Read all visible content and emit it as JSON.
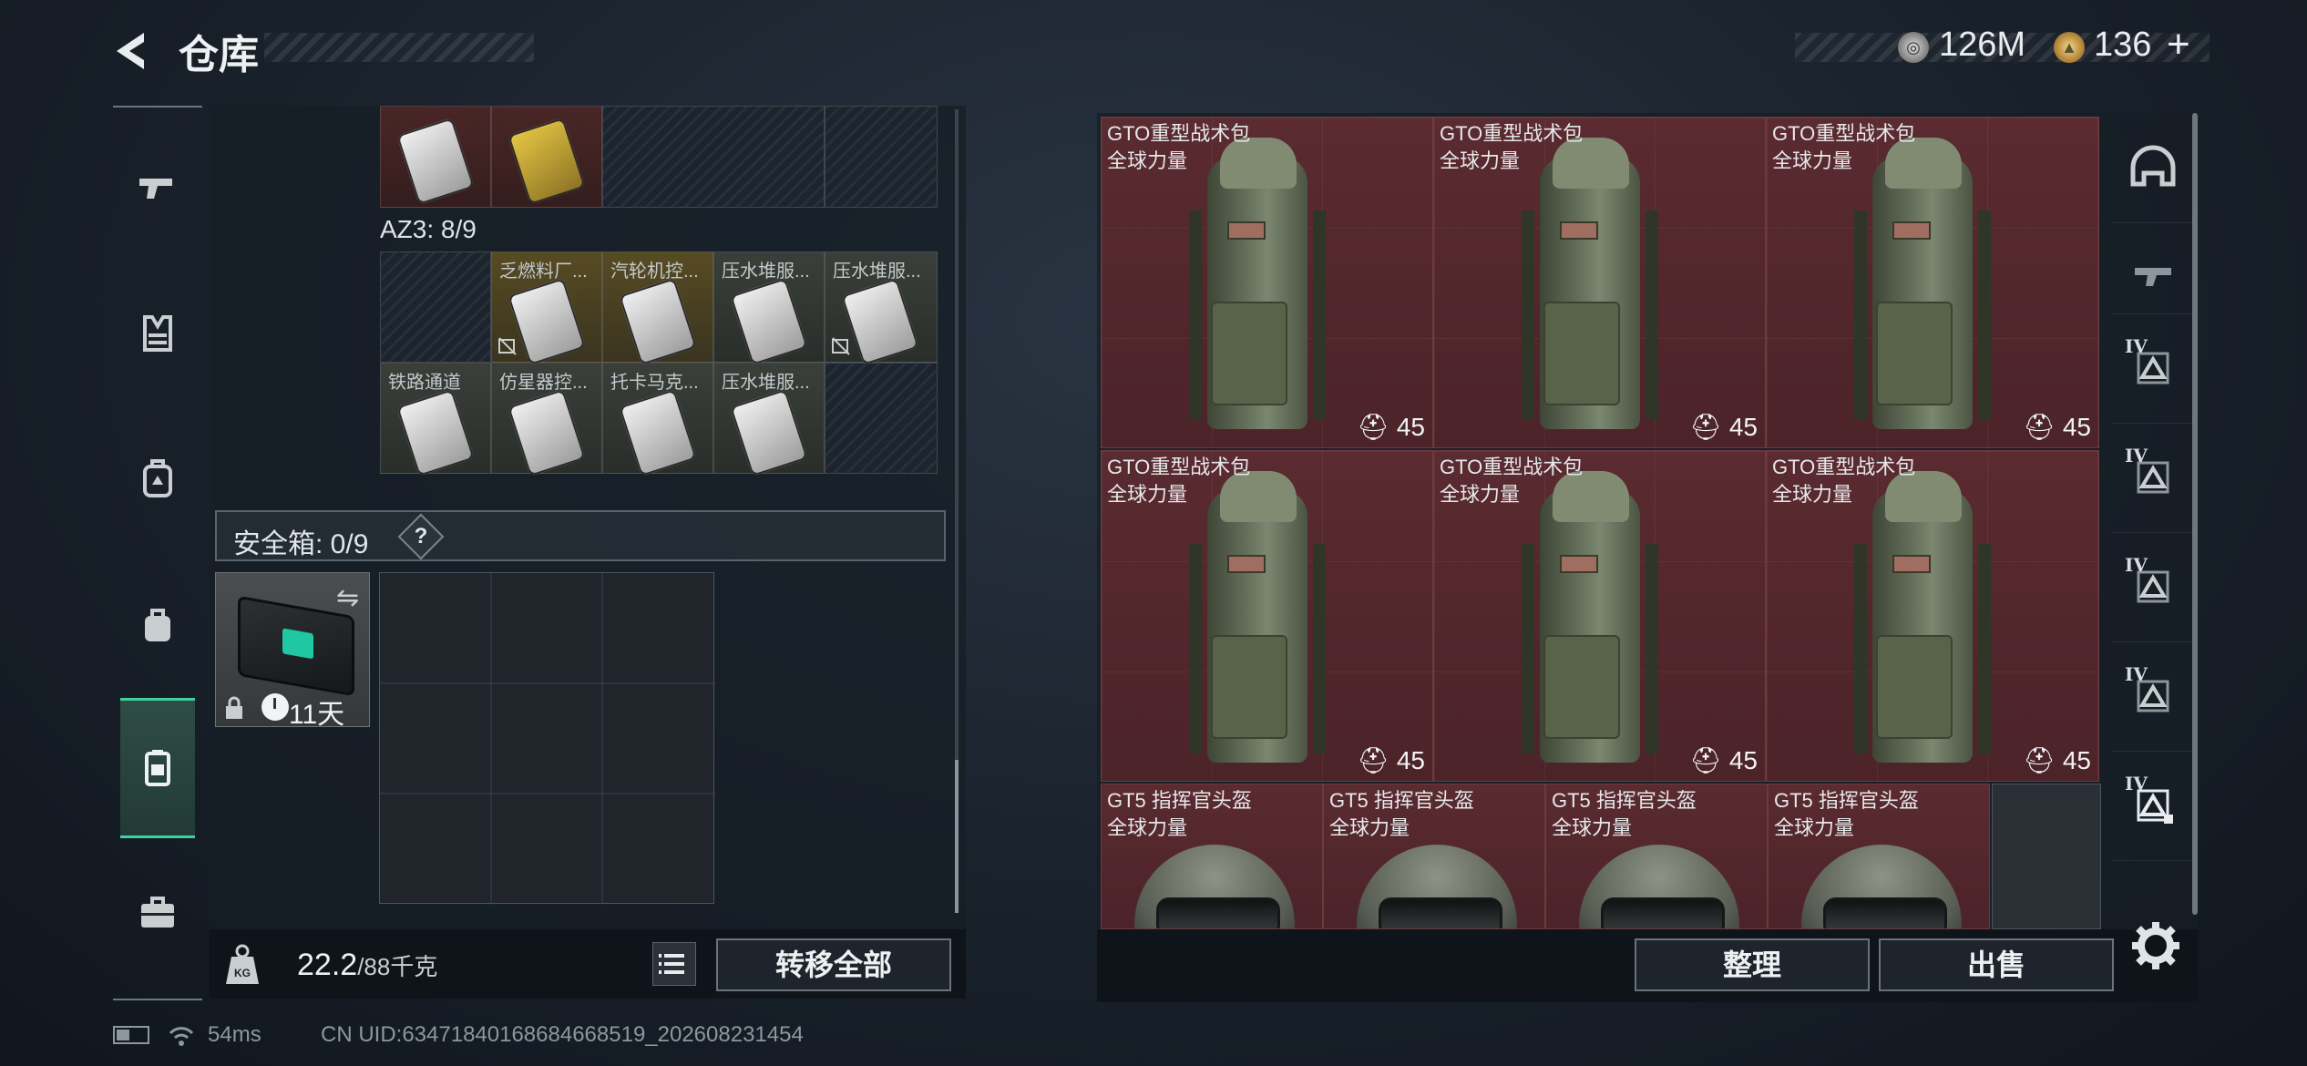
{
  "header": {
    "title": "仓库",
    "currency_silver": "126M",
    "currency_gold": "136",
    "plus": "+"
  },
  "left_nav": [
    "pistol-icon",
    "vest-icon",
    "backpack-icon",
    "bag-icon",
    "container-icon",
    "briefcase-icon"
  ],
  "key_section": {
    "label": "AZ3: 8/9",
    "keys": [
      {
        "name": "乏燃料厂...",
        "color": "yellow"
      },
      {
        "name": "汽轮机控...",
        "color": "yellow"
      },
      {
        "name": "压水堆服...",
        "color": "grey"
      },
      {
        "name": "压水堆服...",
        "color": "grey"
      },
      {
        "name": "铁路通道",
        "color": "grey"
      },
      {
        "name": "仿星器控...",
        "color": "grey"
      },
      {
        "name": "托卡马克...",
        "color": "grey"
      },
      {
        "name": "压水堆服...",
        "color": "grey"
      }
    ]
  },
  "safe": {
    "label": "安全箱: 0/9",
    "help": "?",
    "days": "11天"
  },
  "weight": {
    "current": "22.2",
    "max": "/88千克"
  },
  "buttons": {
    "transfer_all": "转移全部",
    "tidy": "整理",
    "sell": "出售"
  },
  "items": [
    {
      "name": "GTO重型战术包",
      "tag": "全球力量",
      "durability": "45"
    },
    {
      "name": "GTO重型战术包",
      "tag": "全球力量",
      "durability": "45"
    },
    {
      "name": "GTO重型战术包",
      "tag": "全球力量",
      "durability": "45"
    },
    {
      "name": "GTO重型战术包",
      "tag": "全球力量",
      "durability": "45"
    },
    {
      "name": "GTO重型战术包",
      "tag": "全球力量",
      "durability": "45"
    },
    {
      "name": "GTO重型战术包",
      "tag": "全球力量",
      "durability": "45"
    },
    {
      "name": "GT5 指挥官头盔",
      "tag": "全球力量"
    },
    {
      "name": "GT5 指挥官头盔",
      "tag": "全球力量"
    },
    {
      "name": "GT5 指挥官头盔",
      "tag": "全球力量"
    },
    {
      "name": "GT5 指挥官头盔",
      "tag": "全球力量"
    }
  ],
  "right_nav_tiers": [
    "IV",
    "IV",
    "IV",
    "IV",
    "IV"
  ],
  "status": {
    "ping": "54ms",
    "uid": "CN UID:6347184016868466851​9_202608231454"
  }
}
